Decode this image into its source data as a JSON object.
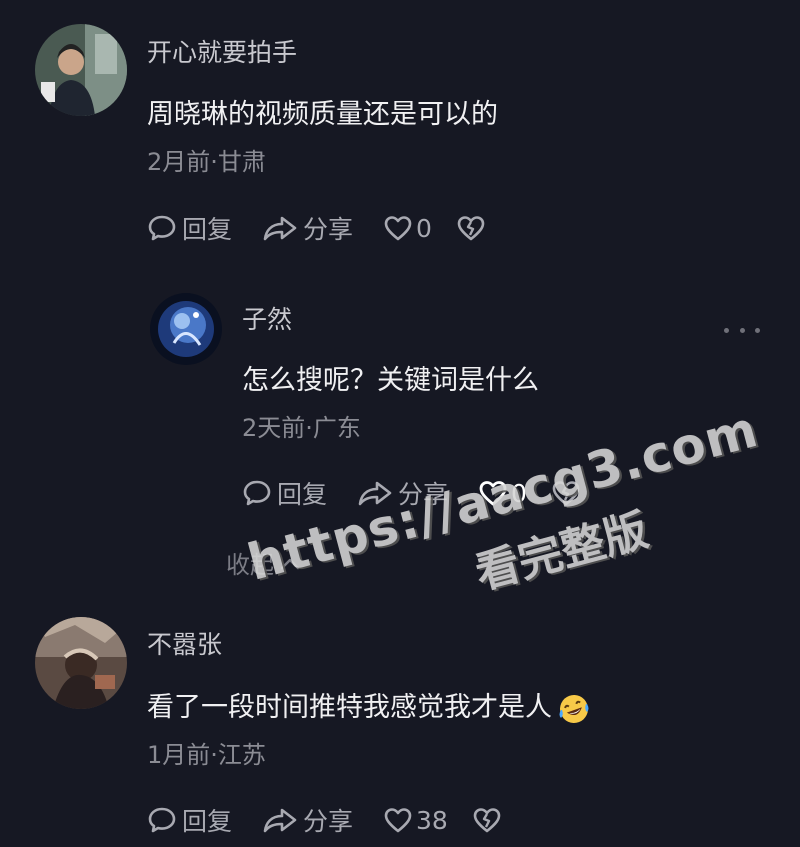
{
  "comments": [
    {
      "username": "开心就要拍手",
      "text": "周晓琳的视频质量还是可以的",
      "meta": "2月前·甘肃",
      "reply_label": "回复",
      "share_label": "分享",
      "likes": "0"
    },
    {
      "username": "子然",
      "text": "怎么搜呢？关键词是什么",
      "meta": "2天前·广东",
      "reply_label": "回复",
      "share_label": "分享",
      "likes": "0"
    },
    {
      "username": "不嚣张",
      "text": "看了一段时间推特我感觉我才是人",
      "meta": "1月前·江苏",
      "reply_label": "回复",
      "share_label": "分享",
      "likes": "38"
    }
  ],
  "collapse_label": "收起",
  "watermark": {
    "url": "https://aacg3.com",
    "subtitle": "看完整版"
  },
  "icons": {
    "reply": "comment-bubble-icon",
    "share": "share-arrow-icon",
    "like": "heart-icon",
    "dislike": "broken-heart-icon",
    "more": "more-dots-icon",
    "collapse": "chevron-up-icon",
    "emoji": "laughing-tears-emoji-icon"
  },
  "colors": {
    "background": "#161823",
    "text": "#f0f0f2",
    "muted": "#8b8c94"
  }
}
